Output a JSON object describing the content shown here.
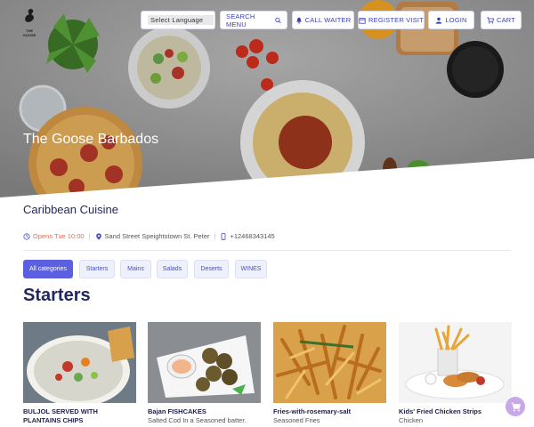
{
  "brand": {
    "logo_text": "THE GOOSE"
  },
  "topnav": {
    "language_select": "Select Language",
    "search_label": "SEARCH MENU",
    "call_waiter_label": "CALL WAITER",
    "register_label": "REGISTER VISIT",
    "login_label": "LOGIN",
    "cart_label": "CART"
  },
  "hero": {
    "title": "The Goose Barbados"
  },
  "restaurant": {
    "cuisine": "Caribbean Cuisine",
    "opens": "Opens Tue 10:00",
    "address": "Sand Street Speightstown St. Peter",
    "phone": "+12468343145"
  },
  "categories": [
    "All categories",
    "Starters",
    "Mains",
    "Salads",
    "Deserts",
    "WINES"
  ],
  "section": {
    "title": "Starters"
  },
  "items": [
    {
      "name": "BULJOL SERVED WITH PLANTAINS CHIPS",
      "desc": ""
    },
    {
      "name": "Bajan FISHCAKES",
      "desc": "Salted Cod In a Seasoned batter."
    },
    {
      "name": "Fries-with-rosemary-salt",
      "desc": "Seasoned Fries"
    },
    {
      "name": "Kids' Fried Chicken Strips",
      "desc": "Chicken"
    }
  ],
  "colors": {
    "accent": "#5b5fe0",
    "primary_text": "#22285e",
    "open_status": "#e96a4f",
    "cart_fab": "#c8a8e8"
  },
  "icons": [
    "search-icon",
    "bell-icon",
    "calendar-icon",
    "user-icon",
    "cart-icon",
    "clock-icon",
    "map-pin-icon",
    "phone-icon"
  ]
}
